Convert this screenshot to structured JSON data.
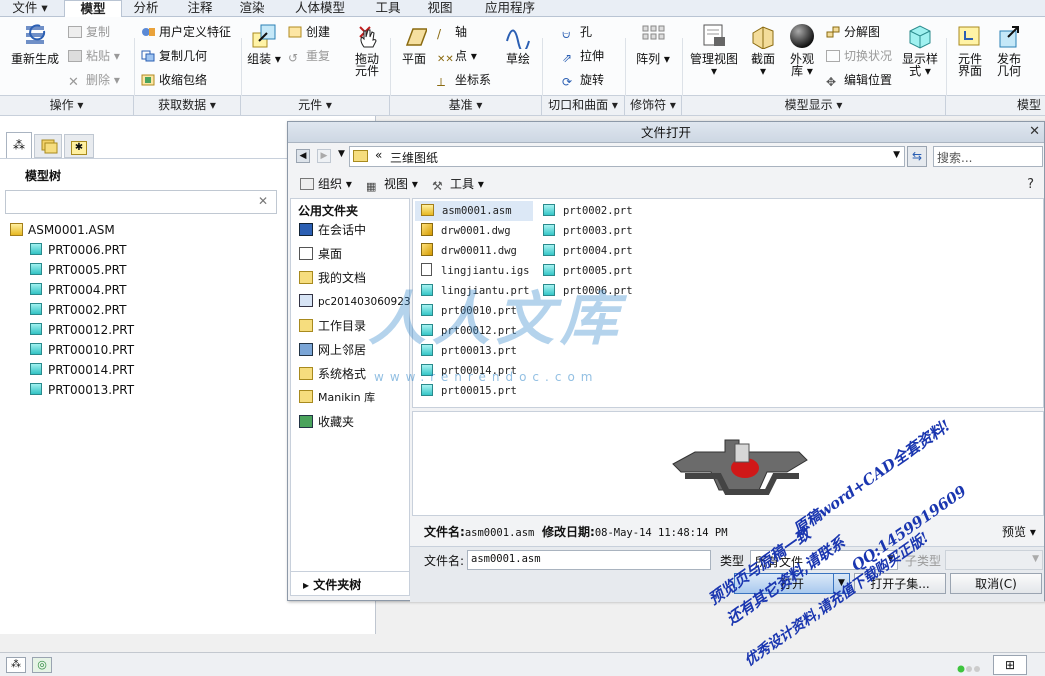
{
  "tabs": [
    "文件",
    "模型",
    "分析",
    "注释",
    "渲染",
    "人体模型",
    "工具",
    "视图",
    "应用程序"
  ],
  "ribbon": {
    "regen": "重新生成",
    "copy": "复制",
    "paste": "粘贴",
    "delete": "删除",
    "udf": "用户定义特征",
    "copy_geom": "复制几何",
    "shrinkwrap": "收缩包络",
    "assemble": "组装",
    "create": "创建",
    "repeat": "重复",
    "drag": [
      "拖动",
      "元件"
    ],
    "plane": "平面",
    "axis": "轴",
    "point": "点",
    "csys": "坐标系",
    "sketch": "草绘",
    "hole": "孔",
    "extrude": "拉伸",
    "revolve": "旋转",
    "pattern": "阵列",
    "manage_views": "管理视图",
    "section": "截面",
    "appearance": [
      "外观",
      "库"
    ],
    "explode": "分解图",
    "toggle_status": "切换状况",
    "edit_position": "编辑位置",
    "display_style": [
      "显示样",
      "式"
    ],
    "comp_interface": [
      "元件",
      "界面"
    ],
    "publish_geom": [
      "发布",
      "几何"
    ]
  },
  "groups": [
    "操作",
    "获取数据",
    "元件",
    "基准",
    "切口和曲面",
    "修饰符",
    "模型显示",
    "模型"
  ],
  "left_panel": {
    "title": "模型树",
    "clear": "✕",
    "items": [
      "ASM0001.ASM",
      "PRT0006.PRT",
      "PRT0005.PRT",
      "PRT0004.PRT",
      "PRT0002.PRT",
      "PRT00012.PRT",
      "PRT00010.PRT",
      "PRT00014.PRT",
      "PRT00013.PRT"
    ]
  },
  "dialog": {
    "title": "文件打开",
    "path_prefix": "«",
    "path": "三维图纸",
    "search_placeholder": "搜索...",
    "organize": "组织",
    "view": "视图",
    "tools": "工具",
    "common_folders": "公用文件夹",
    "places": [
      "在会话中",
      "桌面",
      "我的文档",
      "pc201403060923",
      "工作目录",
      "网上邻居",
      "系统格式",
      "Manikin 库",
      "收藏夹"
    ],
    "files_col1": [
      "asm0001.asm",
      "drw0001.dwg",
      "drw00011.dwg",
      "lingjiantu.igs",
      "lingjiantu.prt",
      "prt00010.prt",
      "prt00012.prt",
      "prt00013.prt",
      "prt00014.prt",
      "prt00015.prt"
    ],
    "files_col2": [
      "prt0002.prt",
      "prt0003.prt",
      "prt0004.prt",
      "prt0005.prt",
      "prt0006.prt"
    ],
    "info_name_label": "文件名:",
    "info_name": "asm0001.asm",
    "info_date_label": "修改日期:",
    "info_date": "08-May-14 11:48:14 PM",
    "preview": "预览",
    "filename_label": "文件名:",
    "filename_value": "asm0001.asm",
    "type_label": "类型",
    "type_value": "所有文件",
    "subtype_label": "子类型",
    "folder_tree": "文件夹树",
    "open": "打开",
    "open_subset": "打开子集...",
    "cancel": "取消(C)"
  },
  "watermark": {
    "site": "人人文库",
    "url": "www.renrendoc.com",
    "line1": "预览页与原稿一致",
    "line2": "原稿word+CAD全套资料!",
    "line3": "QQ:1459919609",
    "line4": "还有其它资料,请联系",
    "line5": "优秀设计资料,请充值下载购买正版!"
  },
  "colors": {
    "accent": "#2b5fb3",
    "part_icon": "#35c6c7",
    "tab_active": "#ffffff"
  }
}
